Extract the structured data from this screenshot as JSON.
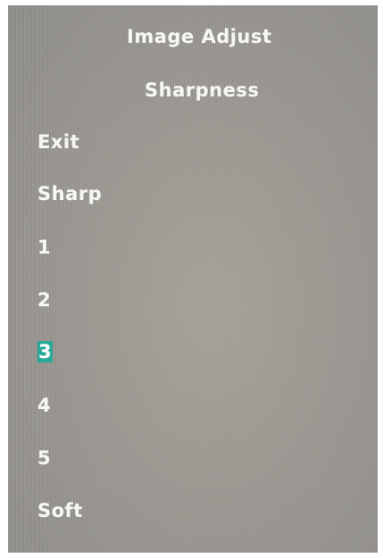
{
  "header": {
    "title": "Image Adjust",
    "subtitle": "Sharpness"
  },
  "menu": {
    "items": [
      {
        "label": "Exit"
      },
      {
        "label": "Sharp"
      },
      {
        "label": "1"
      },
      {
        "label": "2"
      },
      {
        "label": "3",
        "selected": true
      },
      {
        "label": "4"
      },
      {
        "label": "5"
      },
      {
        "label": "Soft"
      }
    ]
  },
  "colors": {
    "text": "#f7f7f2",
    "highlight": "#2aa898",
    "screen": "#9b9892"
  }
}
